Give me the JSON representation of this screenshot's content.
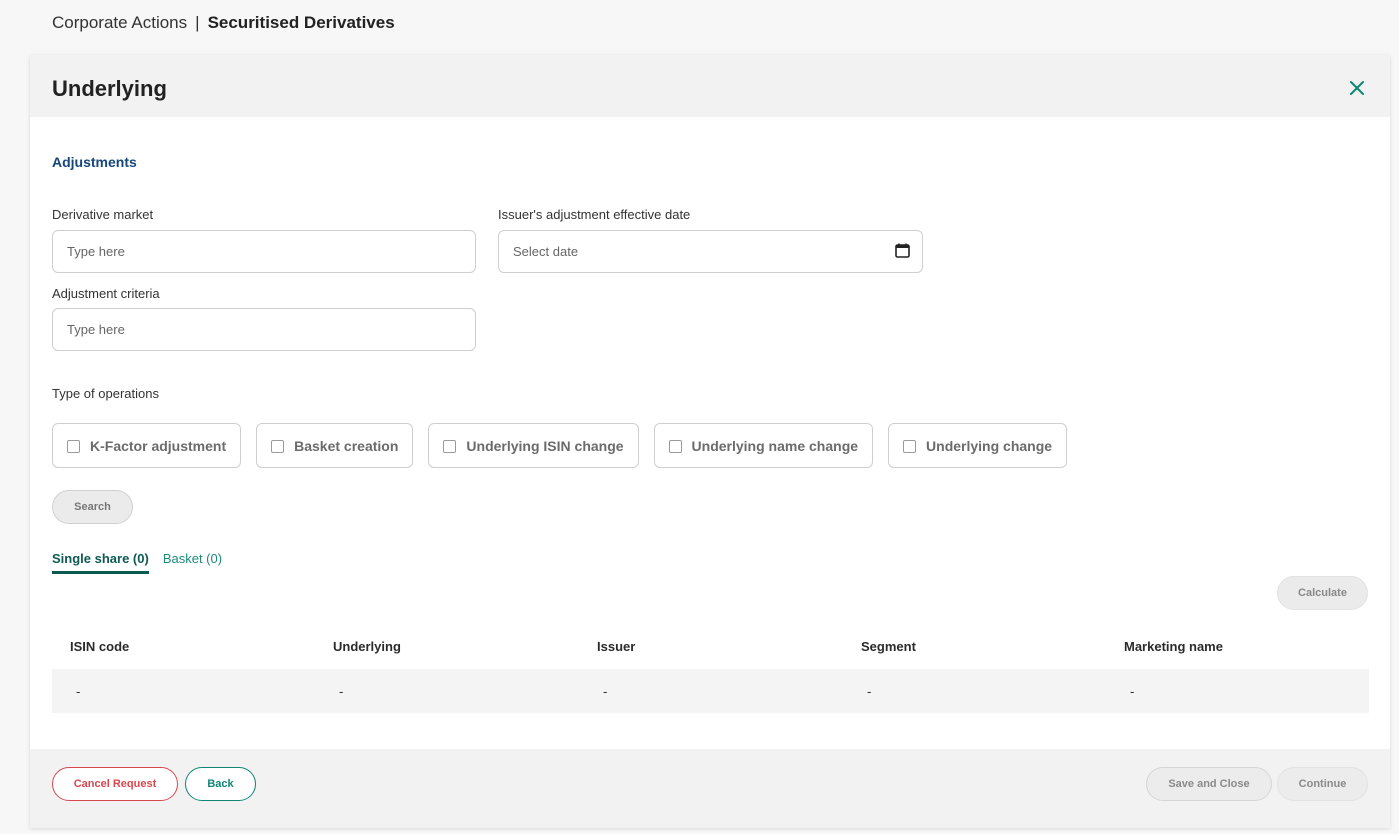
{
  "breadcrumb": {
    "parent": "Corporate Actions",
    "separator": "|",
    "current": "Securitised Derivatives"
  },
  "modal": {
    "title": "Underlying",
    "close_icon": "close-icon"
  },
  "adjustments": {
    "section_title": "Adjustments",
    "derivative_market": {
      "label": "Derivative market",
      "placeholder": "Type here",
      "value": ""
    },
    "effective_date": {
      "label": "Issuer's adjustment effective date",
      "placeholder": "Select date",
      "value": "",
      "icon": "calendar-icon"
    },
    "adjustment_criteria": {
      "label": "Adjustment criteria",
      "placeholder": "Type here",
      "value": ""
    }
  },
  "operations": {
    "label": "Type of operations",
    "items": [
      {
        "label": "K-Factor adjustment",
        "checked": false
      },
      {
        "label": "Basket creation",
        "checked": false
      },
      {
        "label": "Underlying ISIN change",
        "checked": false
      },
      {
        "label": "Underlying name change",
        "checked": false
      },
      {
        "label": "Underlying change",
        "checked": false
      }
    ]
  },
  "search_button": "Search",
  "tabs": [
    {
      "label": "Single share (0)",
      "active": true
    },
    {
      "label": "Basket (0)",
      "active": false
    }
  ],
  "calculate_button": "Calculate",
  "table": {
    "columns": [
      "ISIN code",
      "Underlying",
      "Issuer",
      "Segment",
      "Marketing name"
    ],
    "rows": [
      [
        "-",
        "-",
        "-",
        "-",
        "-"
      ]
    ]
  },
  "footer": {
    "cancel": "Cancel Request",
    "back": "Back",
    "save_close": "Save and Close",
    "continue": "Continue"
  },
  "colors": {
    "accent": "#0f8574",
    "section_title": "#15477a",
    "danger": "#d9474f"
  }
}
